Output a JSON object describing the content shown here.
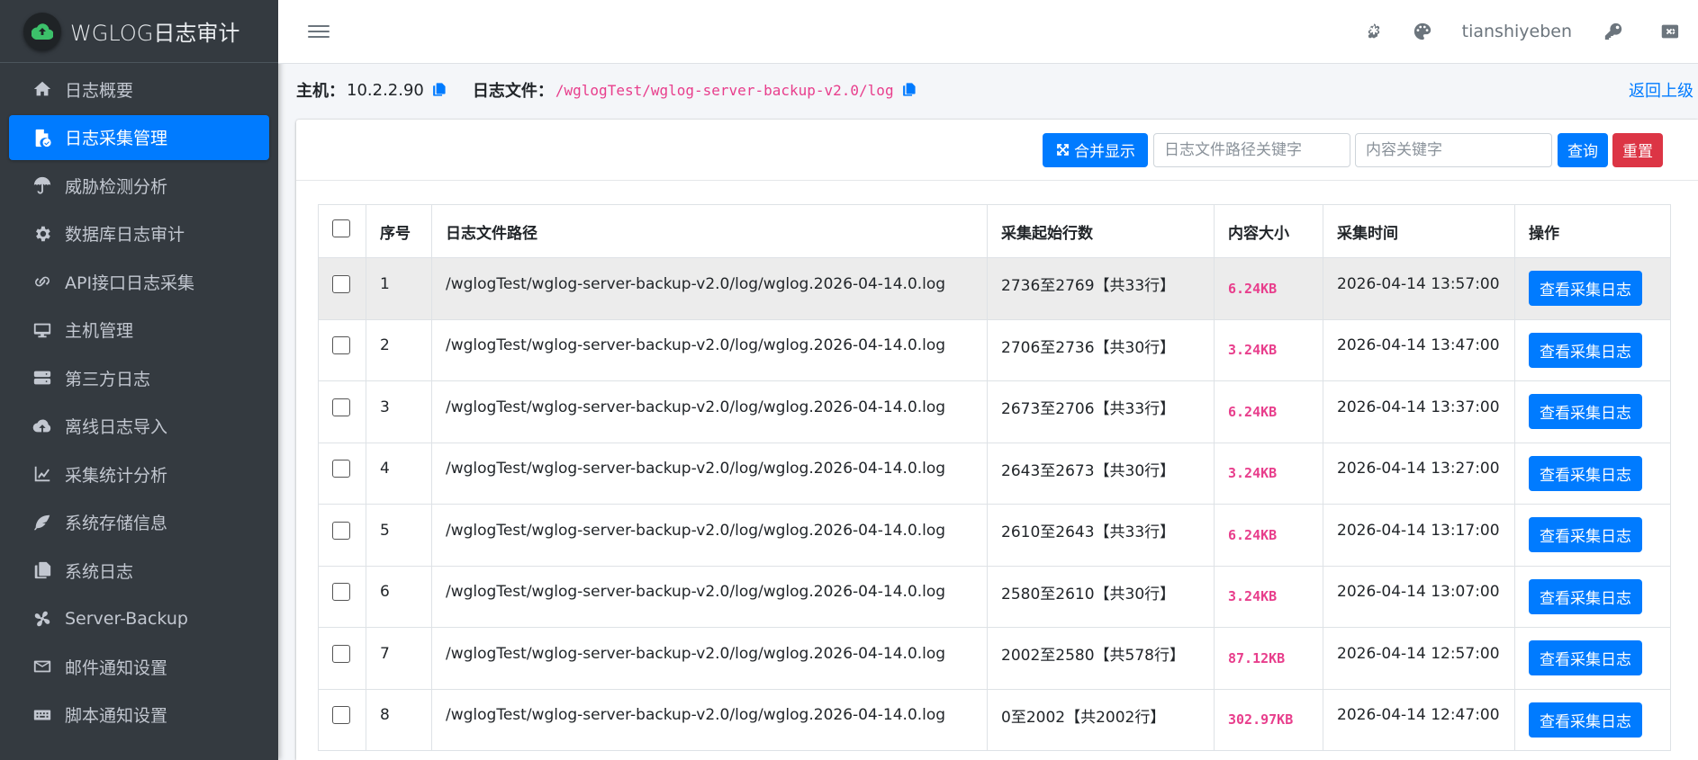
{
  "brand": {
    "title": "WGLOG日志审计",
    "logo_icon": "cloud-upload-icon"
  },
  "sidebar": {
    "items": [
      {
        "label": "日志概要",
        "icon": "home-icon",
        "active": false
      },
      {
        "label": "日志采集管理",
        "icon": "file-check-icon",
        "active": true
      },
      {
        "label": "威胁检测分析",
        "icon": "umbrella-icon",
        "active": false
      },
      {
        "label": "数据库日志审计",
        "icon": "gear-icon",
        "active": false
      },
      {
        "label": "API接口日志采集",
        "icon": "link-icon",
        "active": false
      },
      {
        "label": "主机管理",
        "icon": "desktop-icon",
        "active": false
      },
      {
        "label": "第三方日志",
        "icon": "server-icon",
        "active": false
      },
      {
        "label": "离线日志导入",
        "icon": "cloud-upload-icon",
        "active": false
      },
      {
        "label": "采集统计分析",
        "icon": "chart-line-icon",
        "active": false
      },
      {
        "label": "系统存储信息",
        "icon": "feather-icon",
        "active": false
      },
      {
        "label": "系统日志",
        "icon": "copy-icon",
        "active": false
      },
      {
        "label": "Server-Backup",
        "icon": "fan-icon",
        "active": false
      },
      {
        "label": "邮件通知设置",
        "icon": "envelope-icon",
        "active": false
      },
      {
        "label": "脚本通知设置",
        "icon": "keyboard-icon",
        "active": false
      }
    ]
  },
  "topbar": {
    "menu_icon": "bars-icon",
    "ai_icon": "openai-icon",
    "theme_icon": "palette-icon",
    "username": "tianshiyeben",
    "key_icon": "key-icon",
    "close_icon": "window-close-icon"
  },
  "info": {
    "host_label": "主机：",
    "host_value": "10.2.2.90",
    "file_label": "日志文件：",
    "file_value": "/wglogTest/wglog-server-backup-v2.0/log",
    "back_label": "返回上级"
  },
  "toolbar": {
    "merge_label": "合并显示",
    "path_placeholder": "日志文件路径关键字",
    "content_placeholder": "内容关键字",
    "search_label": "查询",
    "reset_label": "重置"
  },
  "table": {
    "headers": [
      "序号",
      "日志文件路径",
      "采集起始行数",
      "内容大小",
      "采集时间",
      "操作"
    ],
    "action_label": "查看采集日志",
    "rows": [
      {
        "no": "1",
        "path": "/wglogTest/wglog-server-backup-v2.0/log/wglog.2026-04-14.0.log",
        "range": "2736至2769【共33行】",
        "size": "6.24KB",
        "time": "2026-04-14 13:57:00"
      },
      {
        "no": "2",
        "path": "/wglogTest/wglog-server-backup-v2.0/log/wglog.2026-04-14.0.log",
        "range": "2706至2736【共30行】",
        "size": "3.24KB",
        "time": "2026-04-14 13:47:00"
      },
      {
        "no": "3",
        "path": "/wglogTest/wglog-server-backup-v2.0/log/wglog.2026-04-14.0.log",
        "range": "2673至2706【共33行】",
        "size": "6.24KB",
        "time": "2026-04-14 13:37:00"
      },
      {
        "no": "4",
        "path": "/wglogTest/wglog-server-backup-v2.0/log/wglog.2026-04-14.0.log",
        "range": "2643至2673【共30行】",
        "size": "3.24KB",
        "time": "2026-04-14 13:27:00"
      },
      {
        "no": "5",
        "path": "/wglogTest/wglog-server-backup-v2.0/log/wglog.2026-04-14.0.log",
        "range": "2610至2643【共33行】",
        "size": "6.24KB",
        "time": "2026-04-14 13:17:00"
      },
      {
        "no": "6",
        "path": "/wglogTest/wglog-server-backup-v2.0/log/wglog.2026-04-14.0.log",
        "range": "2580至2610【共30行】",
        "size": "3.24KB",
        "time": "2026-04-14 13:07:00"
      },
      {
        "no": "7",
        "path": "/wglogTest/wglog-server-backup-v2.0/log/wglog.2026-04-14.0.log",
        "range": "2002至2580【共578行】",
        "size": "87.12KB",
        "time": "2026-04-14 12:57:00"
      },
      {
        "no": "8",
        "path": "/wglogTest/wglog-server-backup-v2.0/log/wglog.2026-04-14.0.log",
        "range": "0至2002【共2002行】",
        "size": "302.97KB",
        "time": "2026-04-14 12:47:00"
      }
    ]
  },
  "colors": {
    "sidebar_bg": "#343a40",
    "primary": "#007bff",
    "danger": "#dc3545",
    "code_pink": "#e83e8c"
  }
}
